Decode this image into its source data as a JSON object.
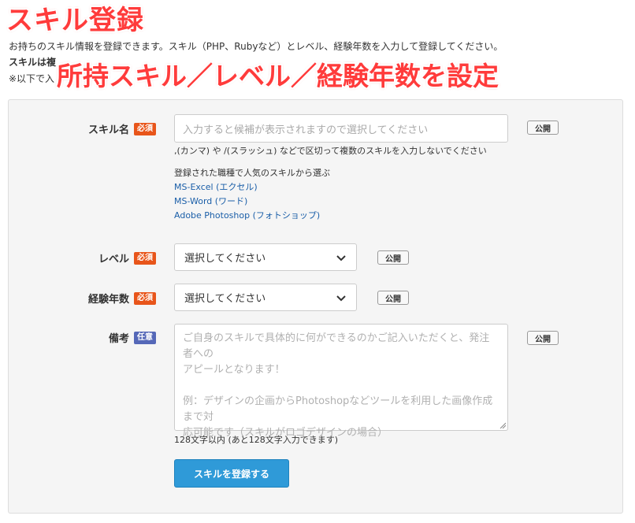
{
  "header": {
    "banner_title": "スキル登録",
    "intro": "お持ちのスキル情報を登録できます。スキル（PHP、Rubyなど）とレベル、経験年数を入力して登録してください。",
    "sub_line1": "スキルは複",
    "sub_line2": "※以下で入",
    "overlay_title": "所持スキル／レベル／経験年数を設定"
  },
  "form": {
    "public_label": "公開",
    "skill": {
      "label": "スキル名",
      "badge": "必須",
      "placeholder": "入力すると候補が表示されますので選択してください",
      "hint": ",(カンマ) や /(スラッシュ) などで区切って複数のスキルを入力しないでください",
      "popular_title": "登録された職種で人気のスキルから選ぶ",
      "popular": [
        "MS-Excel (エクセル)",
        "MS-Word (ワード)",
        "Adobe Photoshop (フォトショップ)"
      ]
    },
    "level": {
      "label": "レベル",
      "badge": "必須",
      "selected": "選択してください"
    },
    "years": {
      "label": "経験年数",
      "badge": "必須",
      "selected": "選択してください"
    },
    "notes": {
      "label": "備考",
      "badge": "任意",
      "placeholder_line1": "ご自身のスキルで具体的に何ができるのかご記入いただくと、発注者への",
      "placeholder_line2": "アピールとなります！",
      "placeholder_line3": "例：デザインの企画からPhotoshopなどツールを利用した画像作成まで対",
      "placeholder_line4": "応可能です（スキルがロゴデザインの場合）",
      "counter": "128文字以内 (あと128文字入力できます)"
    },
    "submit_label": "スキルを登録する"
  },
  "colors": {
    "required_badge": "#e8551a",
    "optional_badge": "#5568b8",
    "submit": "#2f9ad8",
    "link": "#1a5ea8",
    "headline": "#ff3b3b"
  }
}
